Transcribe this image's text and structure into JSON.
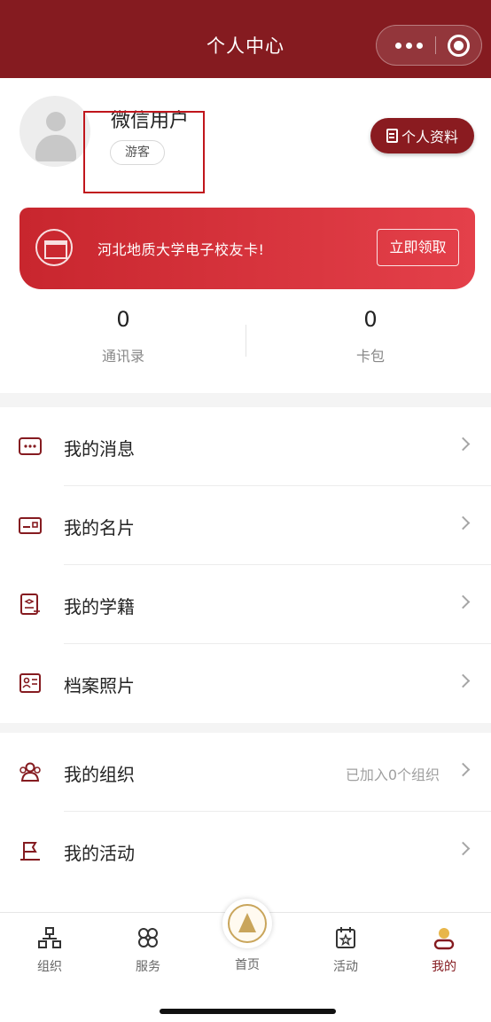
{
  "header": {
    "title": "个人中心"
  },
  "profile": {
    "username": "微信用户",
    "role_badge": "游客",
    "profile_button_label": "个人资料"
  },
  "banner": {
    "text": "河北地质大学电子校友卡!",
    "button_label": "立即领取"
  },
  "stats": [
    {
      "value": "0",
      "label": "通讯录"
    },
    {
      "value": "0",
      "label": "卡包"
    }
  ],
  "menu_group_1": [
    {
      "label": "我的消息",
      "icon": "message-icon"
    },
    {
      "label": "我的名片",
      "icon": "card-icon"
    },
    {
      "label": "我的学籍",
      "icon": "student-record-icon"
    },
    {
      "label": "档案照片",
      "icon": "photo-id-icon"
    }
  ],
  "menu_group_2": [
    {
      "label": "我的组织",
      "icon": "people-icon",
      "sub": "已加入0个组织"
    },
    {
      "label": "我的活动",
      "icon": "flag-icon"
    }
  ],
  "tabbar": [
    {
      "label": "组织",
      "icon": "org-tree-icon"
    },
    {
      "label": "服务",
      "icon": "clover-icon"
    },
    {
      "label": "首页",
      "icon": "university-emblem-icon"
    },
    {
      "label": "活动",
      "icon": "calendar-star-icon"
    },
    {
      "label": "我的",
      "icon": "user-icon",
      "active": true
    }
  ],
  "colors": {
    "primary": "#851b20",
    "banner_gradient_start": "#c8262e",
    "banner_gradient_end": "#e4404a",
    "highlight_box": "#c0161c"
  }
}
